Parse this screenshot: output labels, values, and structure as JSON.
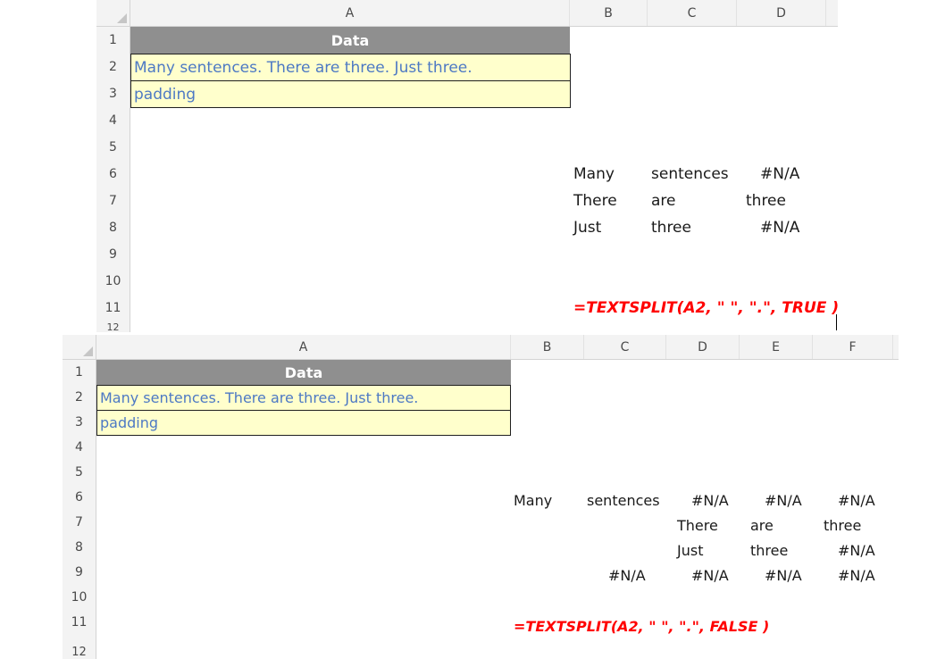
{
  "panel1": {
    "columns": [
      "A",
      "B",
      "C",
      "D"
    ],
    "rows": [
      "1",
      "2",
      "3",
      "4",
      "5",
      "6",
      "7",
      "8",
      "9",
      "10",
      "11",
      "12"
    ],
    "header_cell": "Data",
    "a2": "Many sentences.  There are three.  Just three.",
    "a3": "padding",
    "results": [
      [
        "Many",
        "sentences",
        "#N/A"
      ],
      [
        "There",
        "are",
        "three"
      ],
      [
        "Just",
        "three",
        "#N/A"
      ]
    ],
    "formula": "=TEXTSPLIT(A2, \" \", \".\", TRUE )"
  },
  "panel2": {
    "columns": [
      "A",
      "B",
      "C",
      "D",
      "E",
      "F"
    ],
    "rows": [
      "1",
      "2",
      "3",
      "4",
      "5",
      "6",
      "7",
      "8",
      "9",
      "10",
      "11",
      "12"
    ],
    "header_cell": "Data",
    "a2": "Many sentences.  There are three.  Just three.",
    "a3": "padding",
    "results": [
      [
        "Many",
        "sentences",
        "#N/A",
        "#N/A",
        "#N/A"
      ],
      [
        "",
        "",
        "There",
        "are",
        "three"
      ],
      [
        "",
        "",
        "Just",
        "three",
        "#N/A"
      ],
      [
        "",
        "#N/A",
        "#N/A",
        "#N/A",
        "#N/A"
      ]
    ],
    "formula": "=TEXTSPLIT(A2, \" \", \".\", FALSE )"
  }
}
